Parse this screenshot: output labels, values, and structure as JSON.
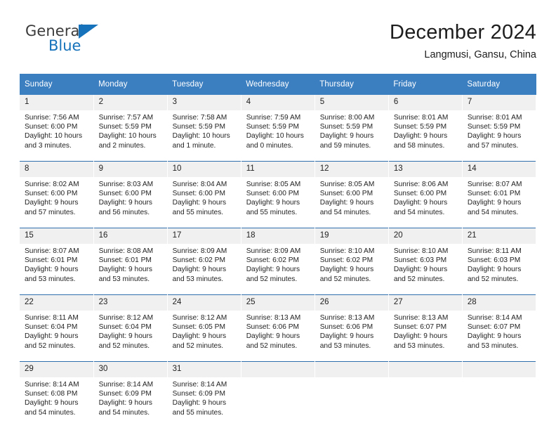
{
  "logo": {
    "word_top": "General",
    "word_bottom": "Blue",
    "triangle_icon": "triangle-icon",
    "blue_hex": "#1673bb"
  },
  "header": {
    "title": "December 2024",
    "subtitle": "Langmusi, Gansu, China"
  },
  "colors": {
    "header_blue": "#3c7fc1",
    "row_divider_blue": "#2f6fae",
    "daynum_band": "#f0f0f0"
  },
  "weekday_headers": [
    "Sunday",
    "Monday",
    "Tuesday",
    "Wednesday",
    "Thursday",
    "Friday",
    "Saturday"
  ],
  "weeks": [
    [
      {
        "day": "1",
        "sunrise": "Sunrise: 7:56 AM",
        "sunset": "Sunset: 6:00 PM",
        "daylight1": "Daylight: 10 hours",
        "daylight2": "and 3 minutes."
      },
      {
        "day": "2",
        "sunrise": "Sunrise: 7:57 AM",
        "sunset": "Sunset: 5:59 PM",
        "daylight1": "Daylight: 10 hours",
        "daylight2": "and 2 minutes."
      },
      {
        "day": "3",
        "sunrise": "Sunrise: 7:58 AM",
        "sunset": "Sunset: 5:59 PM",
        "daylight1": "Daylight: 10 hours",
        "daylight2": "and 1 minute."
      },
      {
        "day": "4",
        "sunrise": "Sunrise: 7:59 AM",
        "sunset": "Sunset: 5:59 PM",
        "daylight1": "Daylight: 10 hours",
        "daylight2": "and 0 minutes."
      },
      {
        "day": "5",
        "sunrise": "Sunrise: 8:00 AM",
        "sunset": "Sunset: 5:59 PM",
        "daylight1": "Daylight: 9 hours",
        "daylight2": "and 59 minutes."
      },
      {
        "day": "6",
        "sunrise": "Sunrise: 8:01 AM",
        "sunset": "Sunset: 5:59 PM",
        "daylight1": "Daylight: 9 hours",
        "daylight2": "and 58 minutes."
      },
      {
        "day": "7",
        "sunrise": "Sunrise: 8:01 AM",
        "sunset": "Sunset: 5:59 PM",
        "daylight1": "Daylight: 9 hours",
        "daylight2": "and 57 minutes."
      }
    ],
    [
      {
        "day": "8",
        "sunrise": "Sunrise: 8:02 AM",
        "sunset": "Sunset: 6:00 PM",
        "daylight1": "Daylight: 9 hours",
        "daylight2": "and 57 minutes."
      },
      {
        "day": "9",
        "sunrise": "Sunrise: 8:03 AM",
        "sunset": "Sunset: 6:00 PM",
        "daylight1": "Daylight: 9 hours",
        "daylight2": "and 56 minutes."
      },
      {
        "day": "10",
        "sunrise": "Sunrise: 8:04 AM",
        "sunset": "Sunset: 6:00 PM",
        "daylight1": "Daylight: 9 hours",
        "daylight2": "and 55 minutes."
      },
      {
        "day": "11",
        "sunrise": "Sunrise: 8:05 AM",
        "sunset": "Sunset: 6:00 PM",
        "daylight1": "Daylight: 9 hours",
        "daylight2": "and 55 minutes."
      },
      {
        "day": "12",
        "sunrise": "Sunrise: 8:05 AM",
        "sunset": "Sunset: 6:00 PM",
        "daylight1": "Daylight: 9 hours",
        "daylight2": "and 54 minutes."
      },
      {
        "day": "13",
        "sunrise": "Sunrise: 8:06 AM",
        "sunset": "Sunset: 6:00 PM",
        "daylight1": "Daylight: 9 hours",
        "daylight2": "and 54 minutes."
      },
      {
        "day": "14",
        "sunrise": "Sunrise: 8:07 AM",
        "sunset": "Sunset: 6:01 PM",
        "daylight1": "Daylight: 9 hours",
        "daylight2": "and 54 minutes."
      }
    ],
    [
      {
        "day": "15",
        "sunrise": "Sunrise: 8:07 AM",
        "sunset": "Sunset: 6:01 PM",
        "daylight1": "Daylight: 9 hours",
        "daylight2": "and 53 minutes."
      },
      {
        "day": "16",
        "sunrise": "Sunrise: 8:08 AM",
        "sunset": "Sunset: 6:01 PM",
        "daylight1": "Daylight: 9 hours",
        "daylight2": "and 53 minutes."
      },
      {
        "day": "17",
        "sunrise": "Sunrise: 8:09 AM",
        "sunset": "Sunset: 6:02 PM",
        "daylight1": "Daylight: 9 hours",
        "daylight2": "and 53 minutes."
      },
      {
        "day": "18",
        "sunrise": "Sunrise: 8:09 AM",
        "sunset": "Sunset: 6:02 PM",
        "daylight1": "Daylight: 9 hours",
        "daylight2": "and 52 minutes."
      },
      {
        "day": "19",
        "sunrise": "Sunrise: 8:10 AM",
        "sunset": "Sunset: 6:02 PM",
        "daylight1": "Daylight: 9 hours",
        "daylight2": "and 52 minutes."
      },
      {
        "day": "20",
        "sunrise": "Sunrise: 8:10 AM",
        "sunset": "Sunset: 6:03 PM",
        "daylight1": "Daylight: 9 hours",
        "daylight2": "and 52 minutes."
      },
      {
        "day": "21",
        "sunrise": "Sunrise: 8:11 AM",
        "sunset": "Sunset: 6:03 PM",
        "daylight1": "Daylight: 9 hours",
        "daylight2": "and 52 minutes."
      }
    ],
    [
      {
        "day": "22",
        "sunrise": "Sunrise: 8:11 AM",
        "sunset": "Sunset: 6:04 PM",
        "daylight1": "Daylight: 9 hours",
        "daylight2": "and 52 minutes."
      },
      {
        "day": "23",
        "sunrise": "Sunrise: 8:12 AM",
        "sunset": "Sunset: 6:04 PM",
        "daylight1": "Daylight: 9 hours",
        "daylight2": "and 52 minutes."
      },
      {
        "day": "24",
        "sunrise": "Sunrise: 8:12 AM",
        "sunset": "Sunset: 6:05 PM",
        "daylight1": "Daylight: 9 hours",
        "daylight2": "and 52 minutes."
      },
      {
        "day": "25",
        "sunrise": "Sunrise: 8:13 AM",
        "sunset": "Sunset: 6:06 PM",
        "daylight1": "Daylight: 9 hours",
        "daylight2": "and 52 minutes."
      },
      {
        "day": "26",
        "sunrise": "Sunrise: 8:13 AM",
        "sunset": "Sunset: 6:06 PM",
        "daylight1": "Daylight: 9 hours",
        "daylight2": "and 53 minutes."
      },
      {
        "day": "27",
        "sunrise": "Sunrise: 8:13 AM",
        "sunset": "Sunset: 6:07 PM",
        "daylight1": "Daylight: 9 hours",
        "daylight2": "and 53 minutes."
      },
      {
        "day": "28",
        "sunrise": "Sunrise: 8:14 AM",
        "sunset": "Sunset: 6:07 PM",
        "daylight1": "Daylight: 9 hours",
        "daylight2": "and 53 minutes."
      }
    ],
    [
      {
        "day": "29",
        "sunrise": "Sunrise: 8:14 AM",
        "sunset": "Sunset: 6:08 PM",
        "daylight1": "Daylight: 9 hours",
        "daylight2": "and 54 minutes."
      },
      {
        "day": "30",
        "sunrise": "Sunrise: 8:14 AM",
        "sunset": "Sunset: 6:09 PM",
        "daylight1": "Daylight: 9 hours",
        "daylight2": "and 54 minutes."
      },
      {
        "day": "31",
        "sunrise": "Sunrise: 8:14 AM",
        "sunset": "Sunset: 6:09 PM",
        "daylight1": "Daylight: 9 hours",
        "daylight2": "and 55 minutes."
      },
      {
        "day": "",
        "sunrise": "",
        "sunset": "",
        "daylight1": "",
        "daylight2": ""
      },
      {
        "day": "",
        "sunrise": "",
        "sunset": "",
        "daylight1": "",
        "daylight2": ""
      },
      {
        "day": "",
        "sunrise": "",
        "sunset": "",
        "daylight1": "",
        "daylight2": ""
      },
      {
        "day": "",
        "sunrise": "",
        "sunset": "",
        "daylight1": "",
        "daylight2": ""
      }
    ]
  ]
}
